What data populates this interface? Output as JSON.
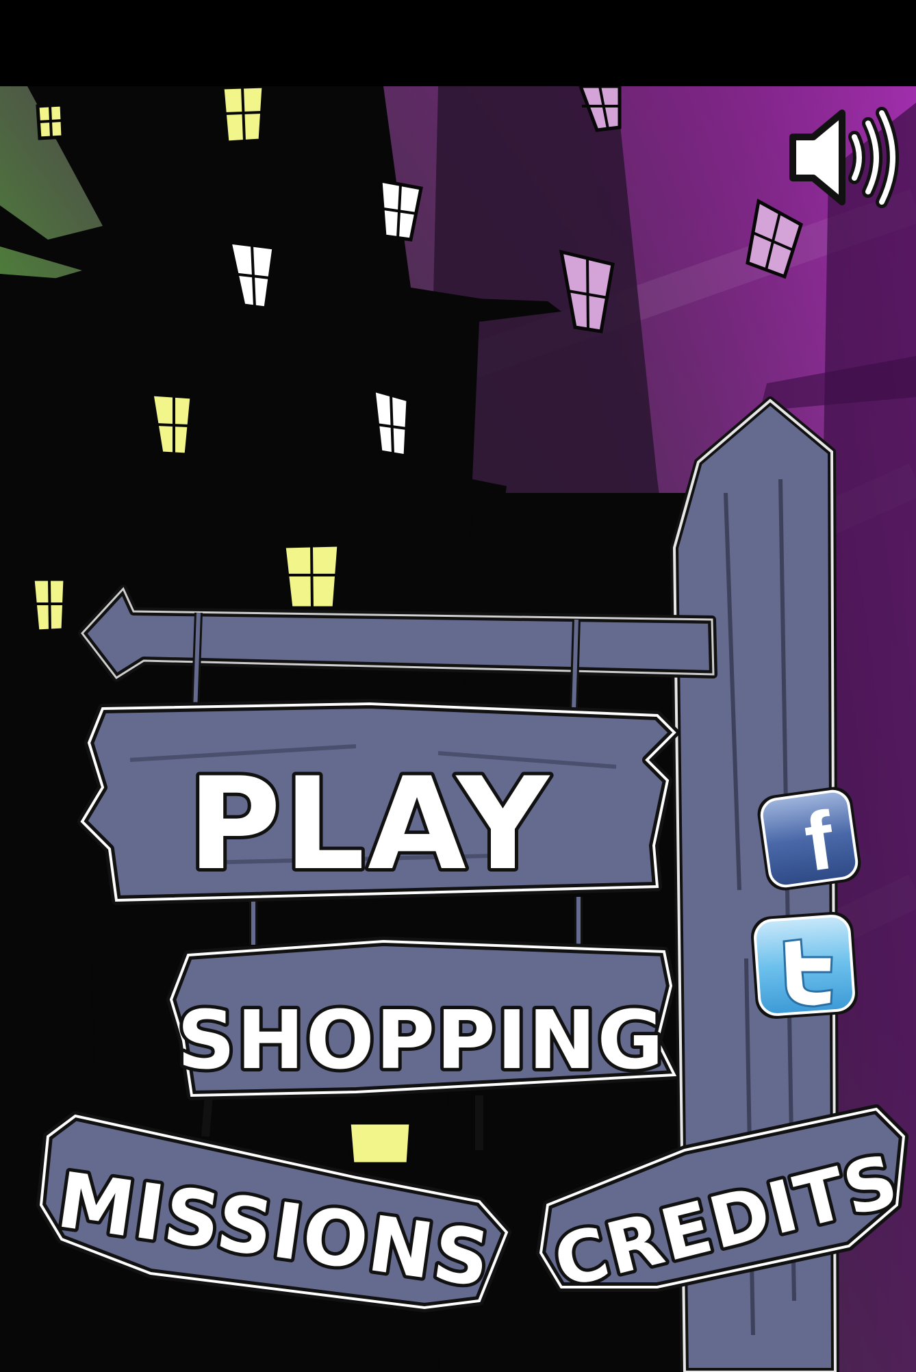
{
  "menu": {
    "play_label": "PLAY",
    "shopping_label": "SHOPPING",
    "missions_label": "MISSIONS",
    "credits_label": "CREDITS"
  },
  "social": {
    "facebook_glyph": "f"
  },
  "icons": {
    "sound": "speaker-volume-icon",
    "facebook": "facebook-icon",
    "twitter": "twitter-bird-icon"
  },
  "colors": {
    "sky_purple": "#7a1f82",
    "sky_green": "#3f8a2a",
    "plank": "#656b8f",
    "plank_light": "#7a80a6",
    "window_yellow": "#f2f58a",
    "facebook_blue": "#3b5998",
    "twitter_blue": "#5bb3e6"
  }
}
